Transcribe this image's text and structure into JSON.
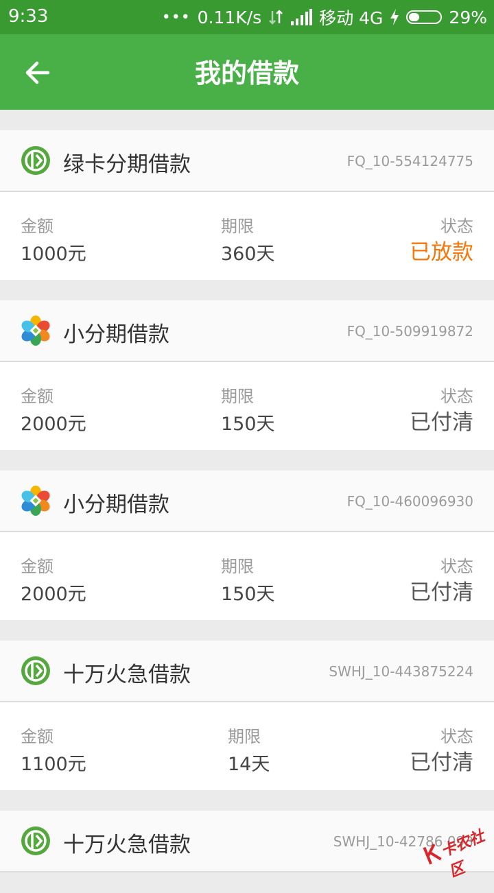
{
  "status_bar": {
    "time": "9:33",
    "net_speed": "0.11K/s",
    "carrier": "移动 4G",
    "battery": "29%"
  },
  "header": {
    "title": "我的借款"
  },
  "loans": [
    {
      "name": "绿卡分期借款",
      "id": "FQ_10-554124775",
      "logo": "green-card-logo",
      "amount_label": "金额",
      "amount": "1000元",
      "term_label": "期限",
      "term": "360天",
      "status_label": "状态",
      "status": "已放款",
      "status_color": "#f5770a"
    },
    {
      "name": "小分期借款",
      "id": "FQ_10-509919872",
      "logo": "colorful-flower-logo",
      "amount_label": "金额",
      "amount": "2000元",
      "term_label": "期限",
      "term": "150天",
      "status_label": "状态",
      "status": "已付清"
    },
    {
      "name": "小分期借款",
      "id": "FQ_10-460096930",
      "logo": "colorful-flower-logo",
      "amount_label": "金额",
      "amount": "2000元",
      "term_label": "期限",
      "term": "150天",
      "status_label": "状态",
      "status": "已付清"
    },
    {
      "name": "十万火急借款",
      "id": "SWHJ_10-443875224",
      "logo": "green-card-logo",
      "amount_label": "金额",
      "amount": "1100元",
      "term_label": "期限",
      "term": "14天",
      "status_label": "状态",
      "status": "已付清"
    },
    {
      "name": "十万火急借款",
      "id": "SWHJ_10-42786",
      "id_tail": "093",
      "logo": "green-card-logo"
    }
  ],
  "watermark": {
    "text": "卡农社区"
  },
  "colors": {
    "header_green": "#49b047",
    "status_bar_green": "#3a9a32",
    "accent_orange": "#f5770a"
  }
}
